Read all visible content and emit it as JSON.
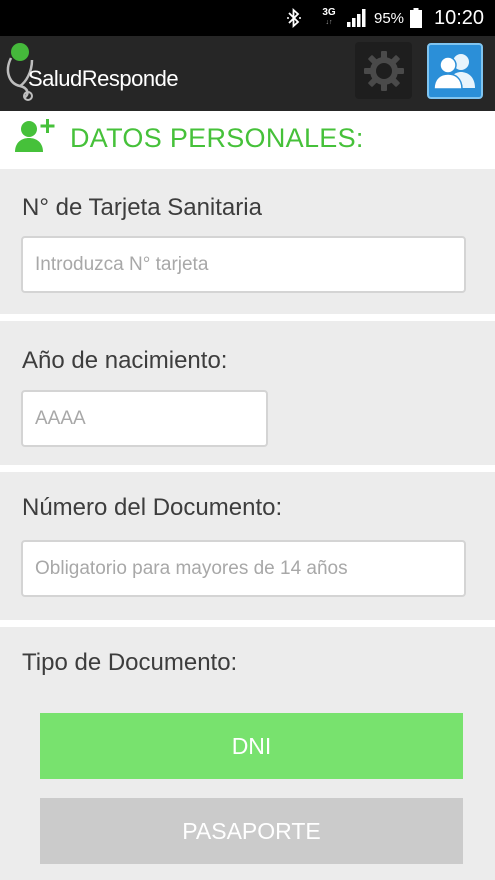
{
  "status_bar": {
    "network": "3G",
    "network_sub": "↓↑",
    "battery_text": "95%",
    "clock": "10:20"
  },
  "app_bar": {
    "logo_text": "SaludResponde",
    "logo_icon": "stethoscope-icon",
    "settings_icon": "gear-icon",
    "profile_icon": "users-icon",
    "accent_color": "#2b8fd8"
  },
  "section": {
    "icon": "add-user-icon",
    "title": "DATOS PERSONALES:",
    "color": "#46c13a"
  },
  "form": {
    "tarjeta": {
      "label": "N° de Tarjeta Sanitaria",
      "placeholder": "Introduzca N° tarjeta",
      "value": ""
    },
    "nacimiento": {
      "label": "Año de nacimiento:",
      "placeholder": "AAAA",
      "value": ""
    },
    "documento": {
      "label": "Número del Documento:",
      "placeholder": "Obligatorio para mayores de 14 años",
      "value": ""
    },
    "tipo_documento": {
      "label": "Tipo de Documento:",
      "options": [
        {
          "label": "DNI",
          "selected": true,
          "color": "#78e26e"
        },
        {
          "label": "PASAPORTE",
          "selected": false,
          "color": "#cbcbcb"
        }
      ]
    }
  }
}
